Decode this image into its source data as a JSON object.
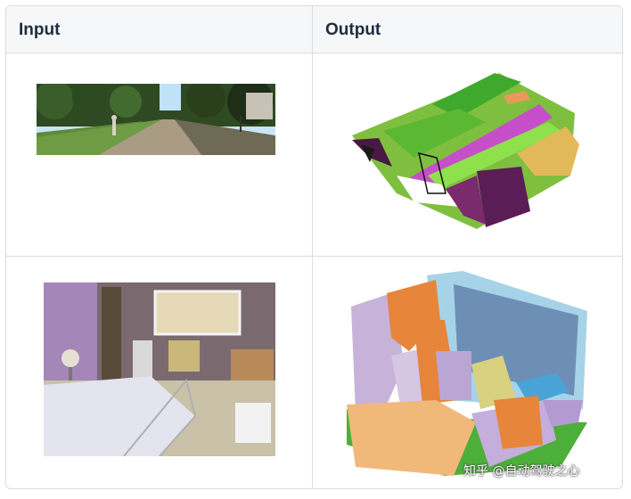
{
  "table": {
    "headers": {
      "input": "Input",
      "output": "Output"
    }
  },
  "rows": [
    {
      "input_image": "street-scene-photo",
      "output_image": "outdoor-semantic-voxel-map"
    },
    {
      "input_image": "bedroom-photo",
      "output_image": "indoor-semantic-voxel-room"
    }
  ],
  "watermark": "知乎 @自动驾驶之心",
  "colors": {
    "header_bg": "#f6f7f9",
    "border": "#dcdcdc",
    "header_text": "#1f2d3d"
  }
}
